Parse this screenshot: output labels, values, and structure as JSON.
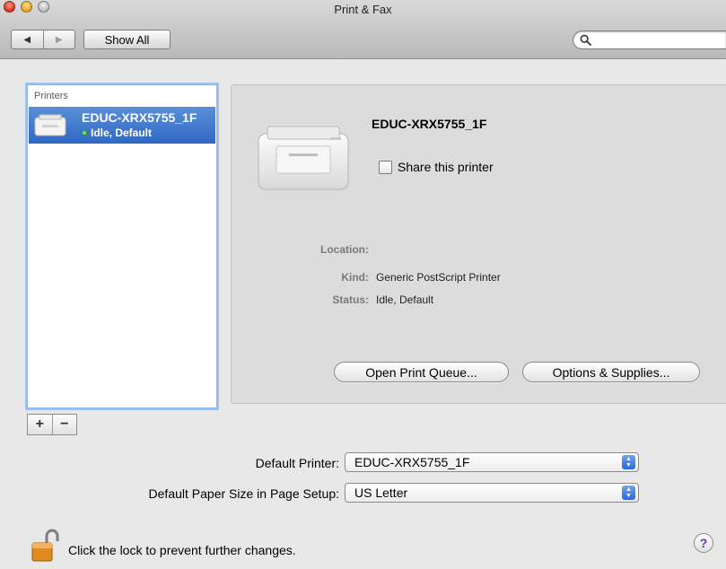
{
  "window": {
    "title": "Print & Fax"
  },
  "toolbar": {
    "back_glyph": "◀",
    "forward_glyph": "▶",
    "show_all_label": "Show All",
    "search": {
      "value": "",
      "placeholder": ""
    }
  },
  "printers_list": {
    "header": "Printers",
    "items": [
      {
        "name": "EDUC-XRX5755_1F",
        "status": "Idle, Default",
        "selected": true
      }
    ],
    "add_label": "+",
    "remove_label": "−"
  },
  "details": {
    "printer_name": "EDUC-XRX5755_1F",
    "share_label": "Share this printer",
    "share_checked": false,
    "location_label": "Location:",
    "location_value": "",
    "kind_label": "Kind:",
    "kind_value": "Generic PostScript Printer",
    "status_label": "Status:",
    "status_value": "Idle, Default",
    "open_queue_label": "Open Print Queue...",
    "options_label": "Options & Supplies..."
  },
  "defaults": {
    "printer_label": "Default Printer:",
    "printer_value": "EDUC-XRX5755_1F",
    "paper_label": "Default Paper Size in Page Setup:",
    "paper_value": "US Letter"
  },
  "footer": {
    "lock_text": "Click the lock to prevent further changes.",
    "help_glyph": "?"
  },
  "colors": {
    "selection": "#2f67c4",
    "status_dot": "#6ee35e",
    "popup_arrows": "#2b68d6"
  }
}
